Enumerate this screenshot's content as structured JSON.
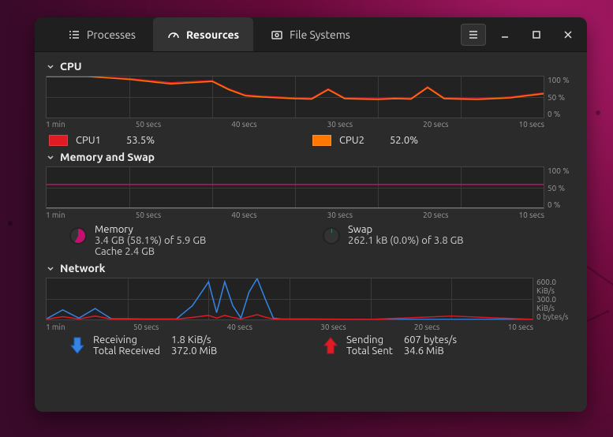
{
  "header": {
    "tabs": [
      {
        "id": "processes",
        "label": "Processes",
        "icon": "list-icon"
      },
      {
        "id": "resources",
        "label": "Resources",
        "icon": "speedometer-icon"
      },
      {
        "id": "filesystems",
        "label": "File Systems",
        "icon": "harddrive-icon"
      }
    ],
    "active_tab": "resources"
  },
  "sections": {
    "cpu": {
      "title": "CPU",
      "ylabels": [
        "100 %",
        "50 %",
        "0 %"
      ],
      "xlabels": [
        "1 min",
        "50 secs",
        "40 secs",
        "30 secs",
        "20 secs",
        "10 secs"
      ],
      "legend": [
        {
          "name": "CPU1",
          "value": "53.5%",
          "color": "#e01b24"
        },
        {
          "name": "CPU2",
          "value": "52.0%",
          "color": "#ff7800"
        }
      ]
    },
    "mem": {
      "title": "Memory and Swap",
      "ylabels": [
        "100 %",
        "50 %",
        "0 %"
      ],
      "xlabels": [
        "1 min",
        "50 secs",
        "40 secs",
        "30 secs",
        "20 secs",
        "10 secs"
      ],
      "memory": {
        "label": "Memory",
        "line": "3.4 GB (58.1%) of 5.9 GB",
        "cache": "Cache 2.4 GB",
        "pct": 58.1,
        "color": "#c30f6f"
      },
      "swap": {
        "label": "Swap",
        "line": "262.1 kB (0.0%) of 3.8 GB",
        "pct": 0.0,
        "color": "#33d17a"
      }
    },
    "net": {
      "title": "Network",
      "ylabels": [
        "600.0 KiB/s",
        "300.0 KiB/s",
        "0 bytes/s"
      ],
      "xlabels": [
        "1 min",
        "50 secs",
        "40 secs",
        "30 secs",
        "20 secs",
        "10 secs"
      ],
      "recv": {
        "label1": "Receiving",
        "val1": "1.8 KiB/s",
        "label2": "Total Received",
        "val2": "372.0 MiB",
        "color": "#3584e4"
      },
      "send": {
        "label1": "Sending",
        "val1": "607 bytes/s",
        "label2": "Total Sent",
        "val2": "34.6 MiB",
        "color": "#e01b24"
      }
    }
  },
  "chart_data": [
    {
      "type": "line",
      "title": "CPU",
      "xlabel": "",
      "ylabel": "",
      "xlim": [
        0,
        60
      ],
      "ylim": [
        0,
        100
      ],
      "x": [
        60,
        55,
        50,
        45,
        40,
        38,
        36,
        34,
        32,
        30,
        28,
        26,
        24,
        22,
        20,
        18,
        16,
        14,
        12,
        10,
        8,
        6,
        4,
        2,
        0
      ],
      "series": [
        {
          "name": "CPU1",
          "color": "#e01b24",
          "values": [
            100,
            100,
            95,
            85,
            90,
            70,
            55,
            52,
            50,
            48,
            47,
            70,
            48,
            47,
            46,
            48,
            47,
            75,
            48,
            47,
            46,
            48,
            50,
            55,
            60
          ]
        },
        {
          "name": "CPU2",
          "color": "#ff7800",
          "values": [
            100,
            100,
            93,
            82,
            88,
            68,
            53,
            50,
            48,
            46,
            45,
            68,
            46,
            45,
            44,
            46,
            45,
            73,
            46,
            45,
            44,
            46,
            48,
            53,
            58
          ]
        }
      ]
    },
    {
      "type": "line",
      "title": "Memory and Swap",
      "xlabel": "",
      "ylabel": "",
      "xlim": [
        0,
        60
      ],
      "ylim": [
        0,
        100
      ],
      "x": [
        60,
        0
      ],
      "series": [
        {
          "name": "Memory",
          "color": "#c30f6f",
          "values": [
            58,
            58
          ]
        },
        {
          "name": "Swap",
          "color": "#33d17a",
          "values": [
            0,
            0
          ]
        }
      ]
    },
    {
      "type": "line",
      "title": "Network",
      "xlabel": "",
      "ylabel": "KiB/s",
      "xlim": [
        0,
        60
      ],
      "ylim": [
        0,
        600
      ],
      "x": [
        60,
        58,
        56,
        54,
        52,
        50,
        48,
        46,
        44,
        42,
        40,
        39,
        38,
        37,
        36,
        35,
        34,
        33,
        32,
        31,
        30,
        28,
        20,
        10,
        0
      ],
      "series": [
        {
          "name": "Receiving",
          "color": "#3584e4",
          "values": [
            10,
            140,
            20,
            160,
            10,
            10,
            5,
            5,
            5,
            200,
            550,
            100,
            550,
            200,
            20,
            400,
            600,
            300,
            20,
            5,
            5,
            5,
            2,
            2,
            2
          ]
        },
        {
          "name": "Sending",
          "color": "#e01b24",
          "values": [
            5,
            40,
            8,
            50,
            6,
            6,
            4,
            4,
            4,
            30,
            60,
            20,
            60,
            30,
            8,
            40,
            70,
            35,
            8,
            4,
            4,
            4,
            1,
            50,
            1
          ]
        }
      ]
    }
  ]
}
